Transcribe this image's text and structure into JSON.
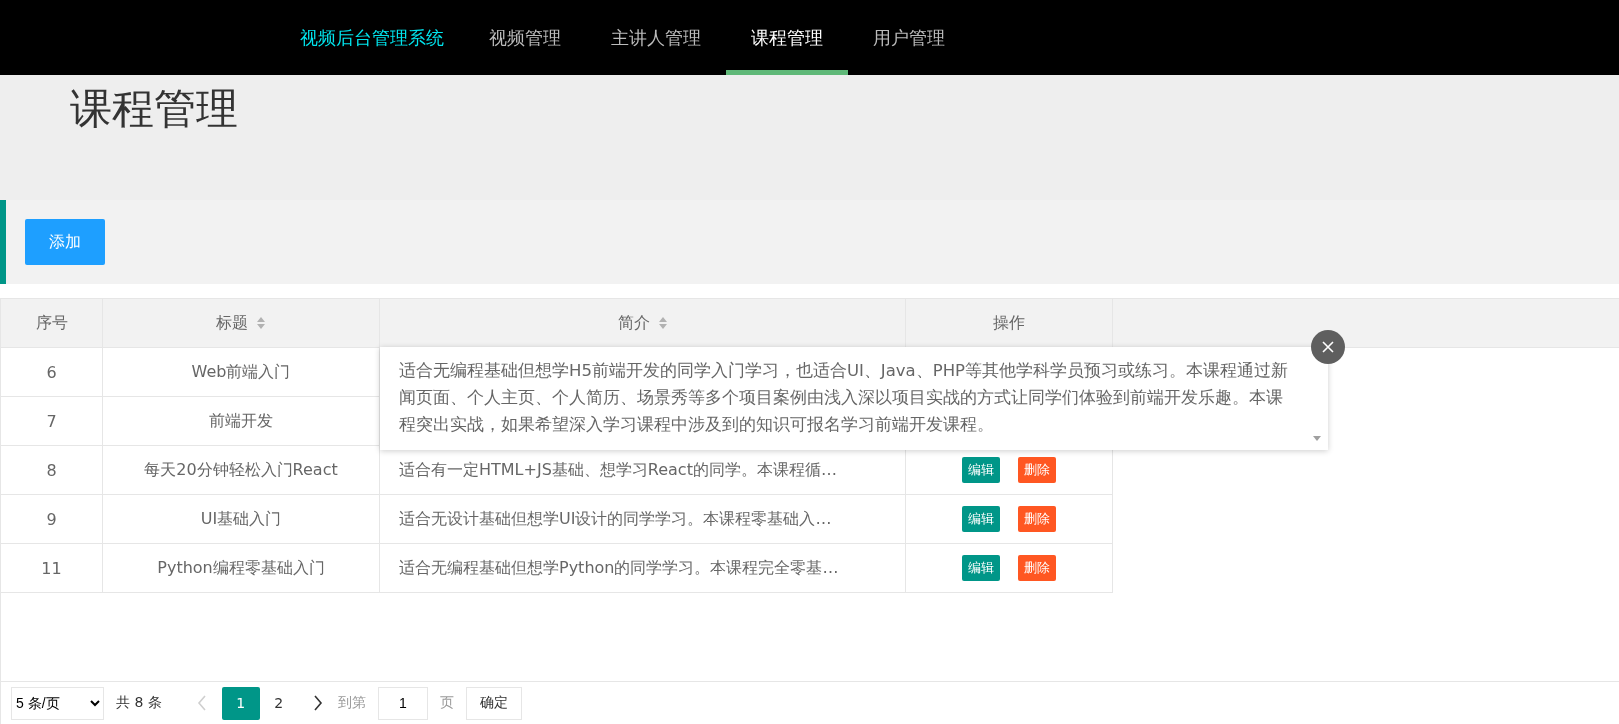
{
  "nav": {
    "logo": "视频后台管理系统",
    "items": [
      {
        "label": "视频管理",
        "selected": false
      },
      {
        "label": "主讲人管理",
        "selected": false
      },
      {
        "label": "课程管理",
        "selected": true
      },
      {
        "label": "用户管理",
        "selected": false
      }
    ]
  },
  "page_title": "课程管理",
  "add_button": "添加",
  "table": {
    "columns": [
      {
        "label": "序号",
        "sortable": false
      },
      {
        "label": "标题",
        "sortable": true
      },
      {
        "label": "简介",
        "sortable": true
      },
      {
        "label": "操作",
        "sortable": false
      }
    ],
    "rows": [
      {
        "index": "6",
        "title": "Web前端入门"
      },
      {
        "index": "7",
        "title": "前端开发"
      },
      {
        "index": "8",
        "title": "每天20分钟轻松入门React",
        "intro": "适合有一定HTML+JS基础、想学习React的同学。本课程循…",
        "actions": [
          "编辑",
          "删除"
        ]
      },
      {
        "index": "9",
        "title": "UI基础入门",
        "intro": "适合无设计基础但想学UI设计的同学学习。本课程零基础入…",
        "actions": [
          "编辑",
          "删除"
        ]
      },
      {
        "index": "11",
        "title": "Python编程零基础入门",
        "intro": "适合无编程基础但想学Python的同学学习。本课程完全零基…",
        "actions": [
          "编辑",
          "删除"
        ]
      }
    ]
  },
  "tooltip": {
    "text": "适合无编程基础但想学H5前端开发的同学入门学习，也适合UI、Java、PHP等其他学科学员预习或练习。本课程通过新闻页面、个人主页、个人简历、场景秀等多个项目案例由浅入深以项目实战的方式让同学们体验到前端开发乐趣。本课程突出实战，如果希望深入学习课程中涉及到的知识可报名学习前端开发课程。"
  },
  "pagination": {
    "page_size": "5 条/页",
    "total": "共 8 条",
    "prev_disabled": true,
    "next_disabled": false,
    "pages": [
      {
        "label": "1",
        "selected": true
      },
      {
        "label": "2",
        "selected": false
      }
    ],
    "goto_label": "到第",
    "goto_value": "1",
    "page_suffix": "页",
    "confirm": "确定"
  }
}
